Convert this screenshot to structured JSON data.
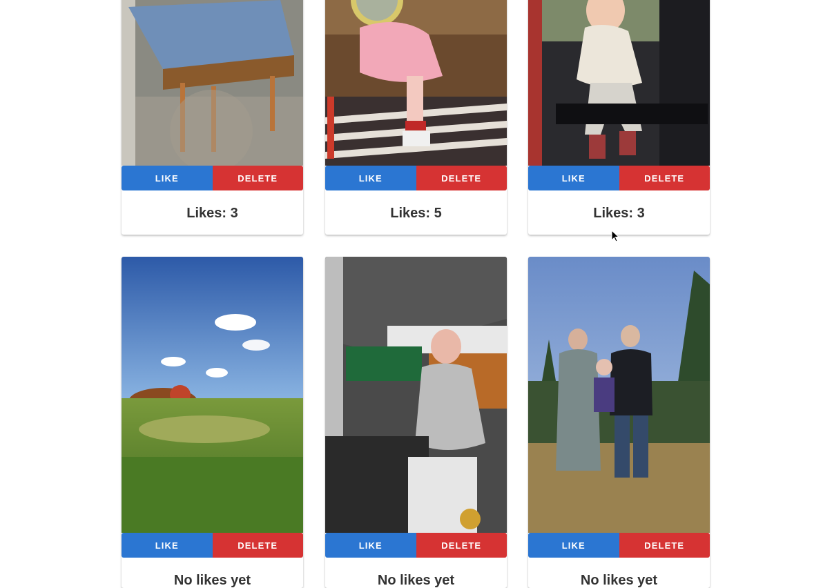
{
  "colors": {
    "like": "#2b76d2",
    "delete": "#d63333"
  },
  "cards": [
    {
      "photo": "chair-photo",
      "like_label": "LIKE",
      "delete_label": "DELETE",
      "likes_text": "Likes: 3"
    },
    {
      "photo": "child-pink-dress-photo",
      "like_label": "LIKE",
      "delete_label": "DELETE",
      "likes_text": "Likes: 5"
    },
    {
      "photo": "child-gondola-photo",
      "like_label": "LIKE",
      "delete_label": "DELETE",
      "likes_text": "Likes: 3"
    },
    {
      "photo": "golf-course-photo",
      "like_label": "LIKE",
      "delete_label": "DELETE",
      "likes_text": "No likes yet"
    },
    {
      "photo": "child-restaurant-photo",
      "like_label": "LIKE",
      "delete_label": "DELETE",
      "likes_text": "No likes yet"
    },
    {
      "photo": "family-tree-farm-photo",
      "like_label": "LIKE",
      "delete_label": "DELETE",
      "likes_text": "No likes yet"
    }
  ]
}
